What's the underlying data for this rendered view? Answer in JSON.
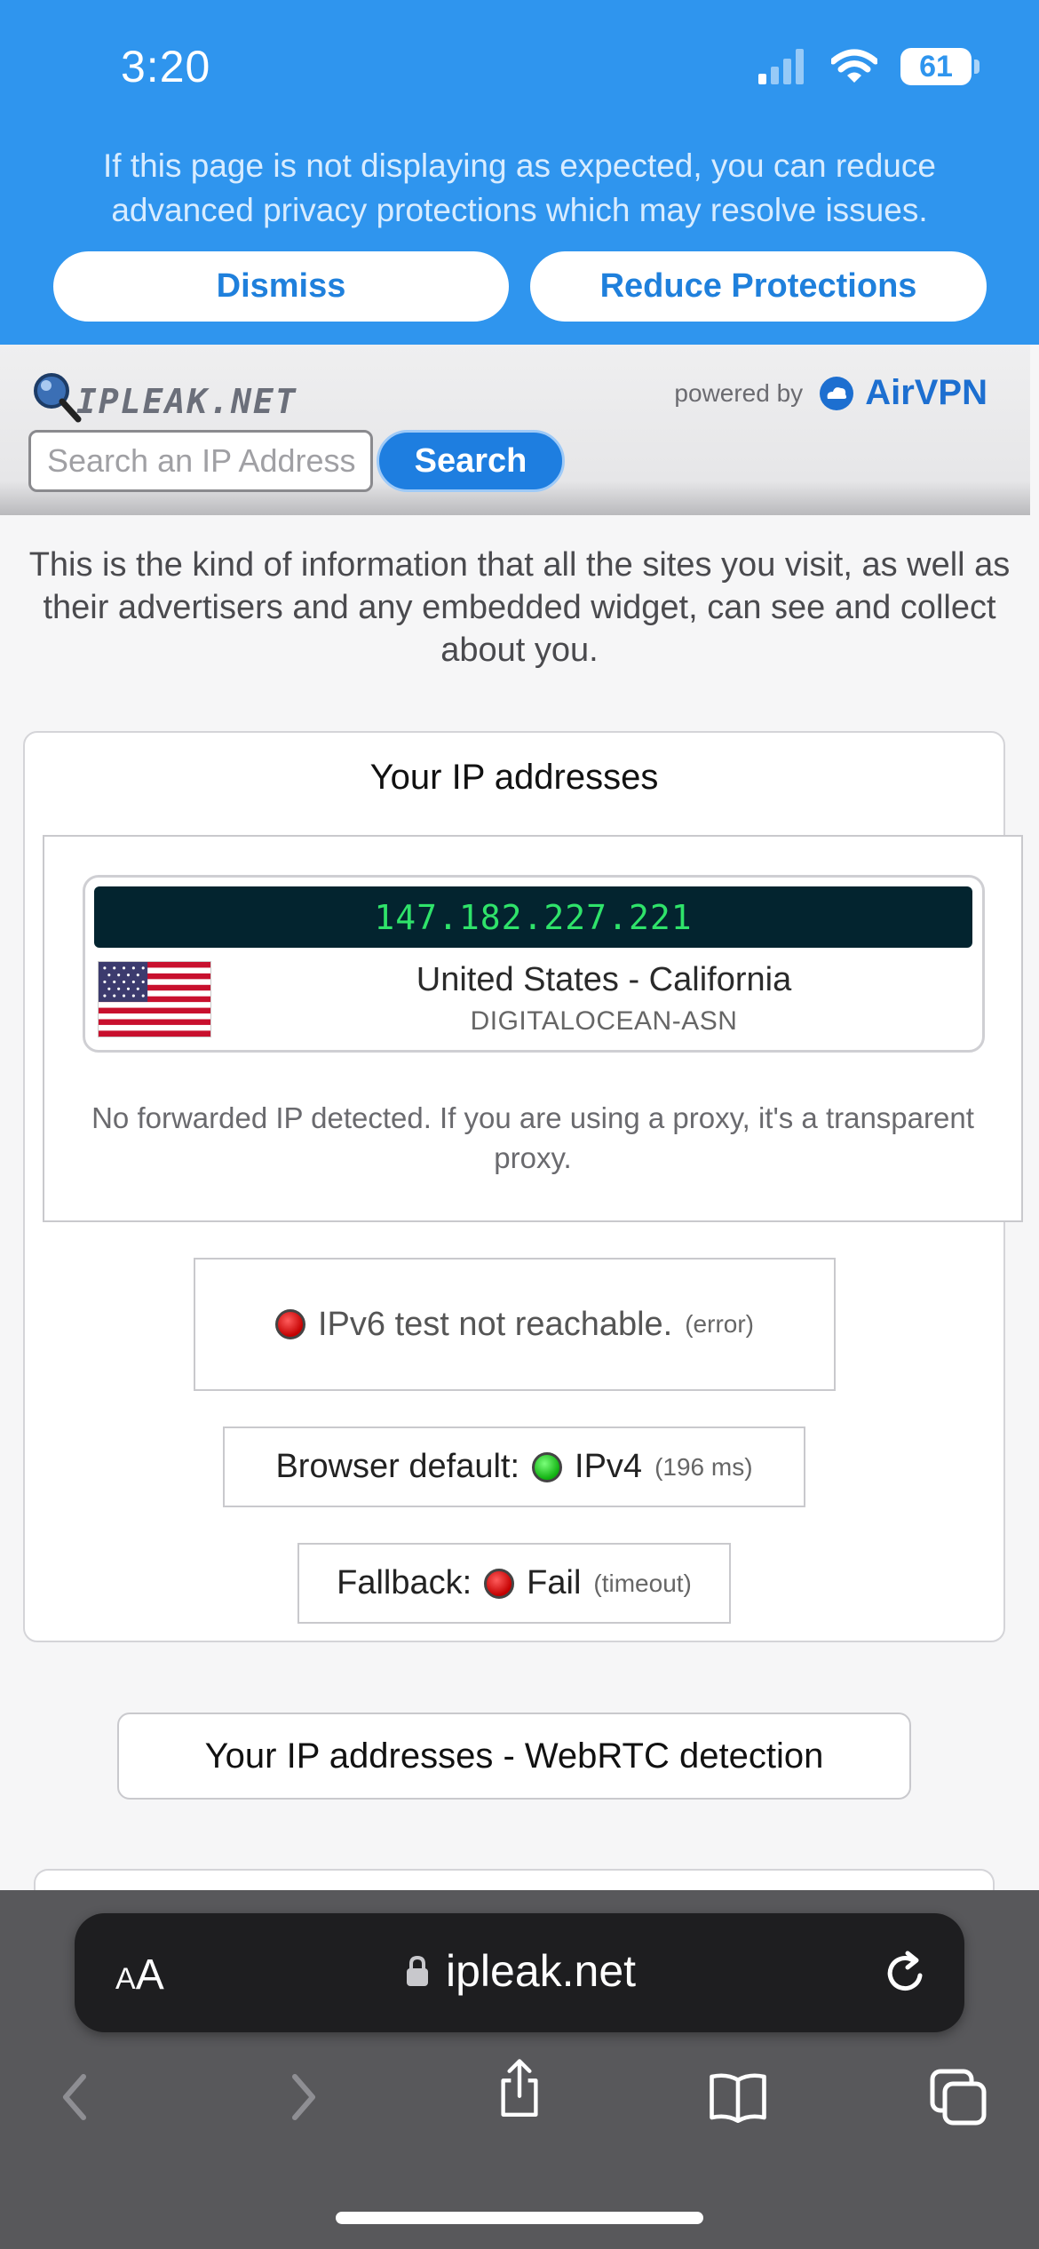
{
  "status_bar": {
    "time": "3:20",
    "battery": "61"
  },
  "privacy_banner": {
    "message": "If this page is not displaying as expected, you can reduce advanced privacy protections which may resolve issues.",
    "dismiss_label": "Dismiss",
    "reduce_label": "Reduce Protections"
  },
  "site_header": {
    "logo_text": "IPLEAK.NET",
    "powered_by": "powered by",
    "brand": "AirVPN",
    "search_placeholder": "Search an IP Address",
    "search_label": "Search"
  },
  "intro": "This is the kind of information that all the sites you visit, as well as their advertisers and any embedded widget, can see and collect about you.",
  "ip_card": {
    "title": "Your IP addresses",
    "ip": "147.182.227.221",
    "location": "United States - California",
    "asn": "DIGITALOCEAN-ASN",
    "forward_note": "No forwarded IP detected. If you are using a proxy, it's a transparent proxy.",
    "ipv6": {
      "text": "IPv6 test not reachable.",
      "detail": "(error)",
      "status_color": "#c40000"
    },
    "browser_default": {
      "label": "Browser default:",
      "value": "IPv4",
      "detail": "(196 ms)",
      "status_color": "#10b010"
    },
    "fallback": {
      "label": "Fallback:",
      "value": "Fail",
      "detail": "(timeout)",
      "status_color": "#c40000"
    }
  },
  "webrtc": {
    "title": "Your IP addresses - WebRTC detection"
  },
  "browser": {
    "aa_small": "A",
    "aa_large": "A",
    "url": "ipleak.net"
  },
  "colors": {
    "accent": "#2f95ee",
    "link": "#1e7ee0",
    "ip_text": "#2fe36a",
    "ip_bg": "#03242f"
  },
  "icons": [
    "signal-icon",
    "wifi-icon",
    "battery-icon",
    "magnifier-logo-icon",
    "airvpn-cloud-icon",
    "us-flag-icon",
    "lock-icon",
    "reload-icon",
    "back-icon",
    "forward-icon",
    "share-icon",
    "bookmarks-icon",
    "tabs-icon"
  ]
}
